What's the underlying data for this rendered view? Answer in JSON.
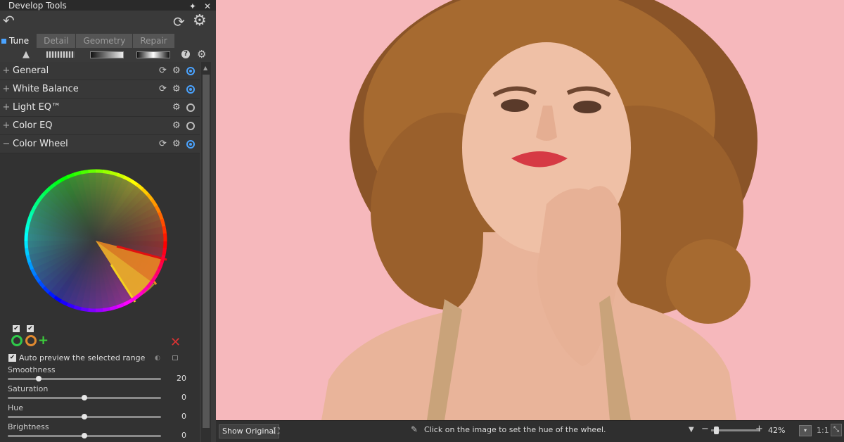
{
  "panel": {
    "title": "Develop Tools",
    "tabs": [
      "Tune",
      "Detail",
      "Geometry",
      "Repair"
    ],
    "sections": [
      {
        "label": "General",
        "expanded": false,
        "has_reset": true,
        "active": true
      },
      {
        "label": "White Balance",
        "expanded": false,
        "has_reset": true,
        "active": true
      },
      {
        "label": "Light EQ™",
        "expanded": false,
        "has_reset": false,
        "active": false
      },
      {
        "label": "Color EQ",
        "expanded": false,
        "has_reset": false,
        "active": false
      },
      {
        "label": "Color Wheel",
        "expanded": true,
        "has_reset": true,
        "active": true
      }
    ],
    "color_wheel": {
      "auto_preview_label": "Auto preview the selected range",
      "sliders": [
        {
          "label": "Smoothness",
          "value": "20",
          "fraction": 0.2
        },
        {
          "label": "Saturation",
          "value": "0",
          "fraction": 0.5
        },
        {
          "label": "Hue",
          "value": "0",
          "fraction": 0.5
        },
        {
          "label": "Brightness",
          "value": "0",
          "fraction": 0.5
        }
      ]
    }
  },
  "statusbar": {
    "show_original": "Show Original",
    "hint": "Click on the image to set the hue of the wheel.",
    "zoom": "42%",
    "zoom_fraction": 0.42,
    "one_to_one": "1:1"
  },
  "colors": {
    "accent": "#4aa3ff",
    "photo_background": "#f6b8bc"
  }
}
